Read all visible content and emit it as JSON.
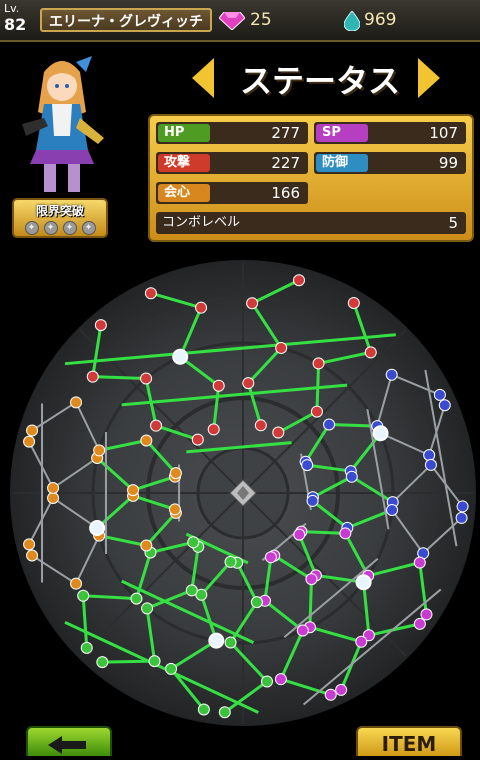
{
  "header": {
    "level_label": "Lv.",
    "level": "82",
    "character_name": "エリーナ・グレヴィッチ",
    "gems": "25",
    "drops": "969"
  },
  "character": {
    "limit_break_label": "限界突破",
    "limit_break_stars": 4,
    "limit_break_filled": 0
  },
  "status": {
    "title": "ステータス",
    "hp_label": "HP",
    "hp": "277",
    "sp_label": "SP",
    "sp": "107",
    "atk_label": "攻撃",
    "atk": "227",
    "def_label": "防御",
    "def": "99",
    "crit_label": "会心",
    "crit": "166",
    "combo_label": "コンボレベル",
    "combo": "5"
  },
  "buttons": {
    "back_icon": "left-arrow-icon",
    "item_label": "ITEM"
  },
  "colors": {
    "hp": "#4f9c22",
    "sp": "#b63fc1",
    "atk": "#cf3b2a",
    "def": "#2e8ec2",
    "crit": "#d7871d",
    "line_active": "#35e043",
    "orb_red": "#d23a3a",
    "orb_blue": "#3a4bd2",
    "orb_green": "#3bc43b",
    "orb_purple": "#c93bd2",
    "orb_orange": "#e08a1e"
  }
}
